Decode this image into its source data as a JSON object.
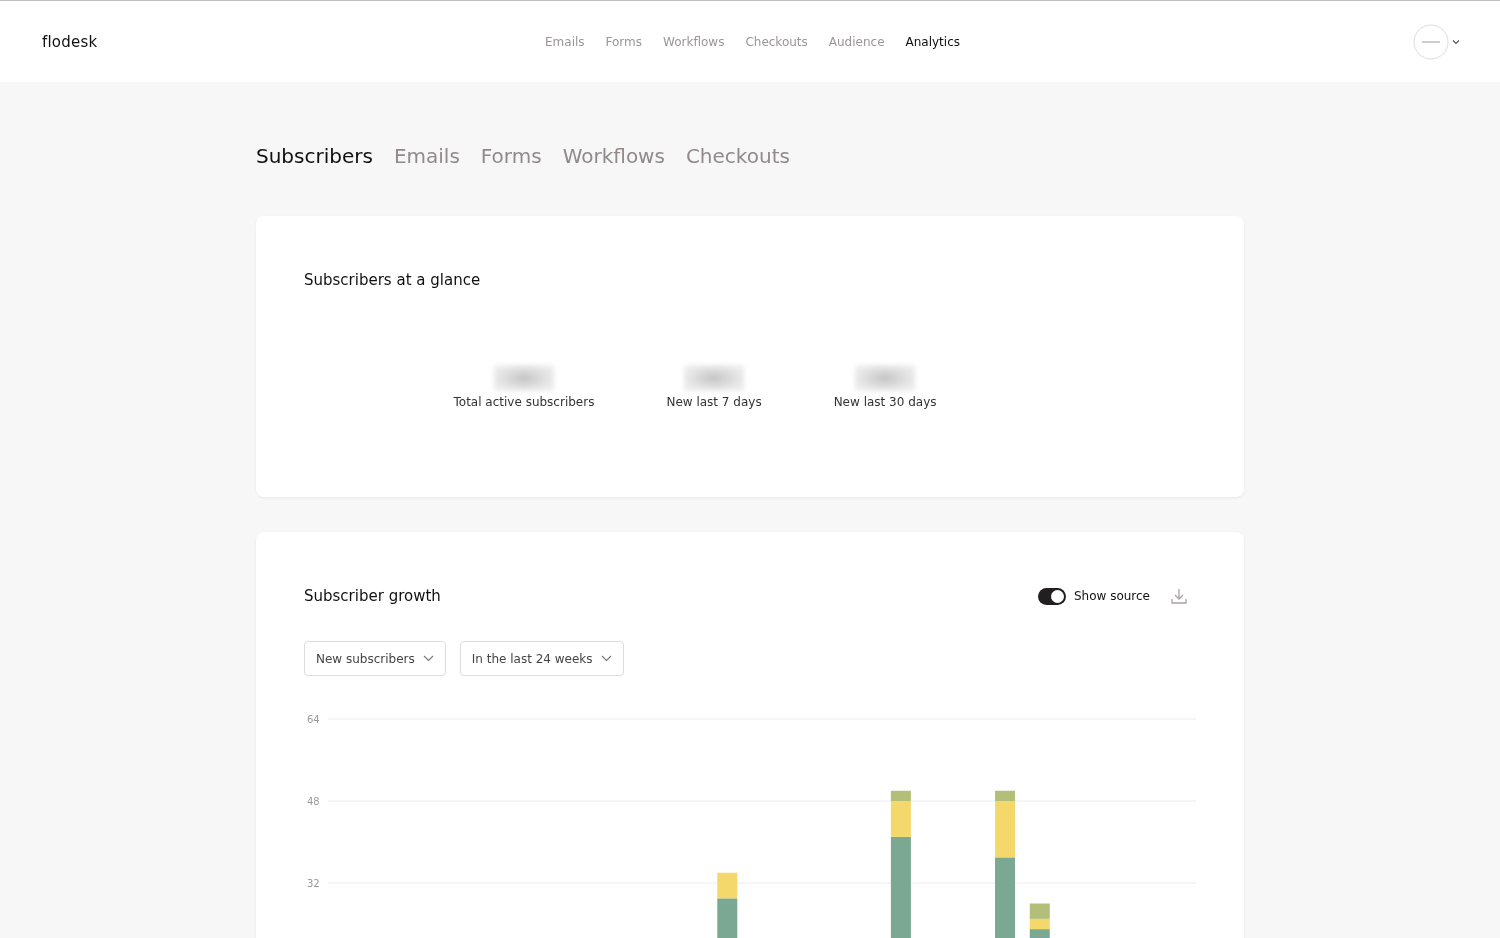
{
  "brand": "flodesk",
  "nav": [
    {
      "label": "Emails",
      "selected": false
    },
    {
      "label": "Forms",
      "selected": false
    },
    {
      "label": "Workflows",
      "selected": false
    },
    {
      "label": "Checkouts",
      "selected": false
    },
    {
      "label": "Audience",
      "selected": false
    },
    {
      "label": "Analytics",
      "selected": true
    }
  ],
  "tabs": [
    {
      "label": "Subscribers",
      "selected": true
    },
    {
      "label": "Emails",
      "selected": false
    },
    {
      "label": "Forms",
      "selected": false
    },
    {
      "label": "Workflows",
      "selected": false
    },
    {
      "label": "Checkouts",
      "selected": false
    }
  ],
  "glance": {
    "title": "Subscribers at a glance",
    "stats": [
      {
        "kind": "blurred",
        "label": "Total active subscribers"
      },
      {
        "kind": "blurred",
        "label": "New last 7 days"
      },
      {
        "kind": "blurred",
        "label": "New last 30 days"
      }
    ]
  },
  "growth": {
    "title": "Subscriber growth",
    "show_source": {
      "label": "Show source",
      "on": true
    },
    "filters": [
      {
        "value": "New subscribers"
      },
      {
        "value": "In the last 24 weeks"
      }
    ],
    "chart_data": {
      "type": "bar",
      "stacked": true,
      "ylim": [
        0,
        64
      ],
      "yticks": [
        32,
        48,
        64
      ],
      "series": [
        {
          "color": "#7aa893",
          "values": [
            0,
            0,
            0,
            0,
            0,
            0,
            0,
            0,
            0,
            0,
            0,
            29,
            0,
            0,
            0,
            0,
            41,
            0,
            0,
            37,
            23,
            0,
            0,
            0,
            0
          ]
        },
        {
          "color": "#f5d86c",
          "values": [
            0,
            0,
            0,
            0,
            0,
            0,
            0,
            0,
            0,
            0,
            0,
            5,
            0,
            0,
            0,
            0,
            7,
            0,
            0,
            11,
            2,
            0,
            0,
            0,
            0
          ]
        },
        {
          "color": "#b3bf78",
          "values": [
            0,
            0,
            0,
            0,
            0,
            0,
            0,
            0,
            0,
            0,
            0,
            0,
            0,
            0,
            0,
            0,
            2,
            0,
            0,
            2,
            3,
            0,
            0,
            0,
            0
          ]
        }
      ]
    }
  }
}
